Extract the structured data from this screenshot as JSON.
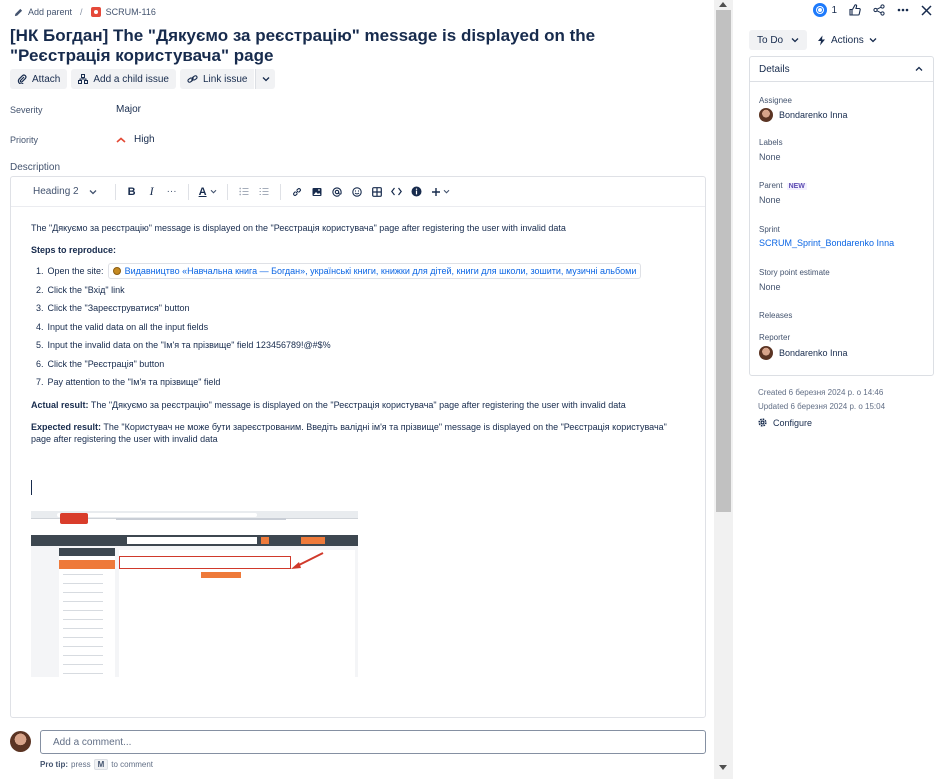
{
  "breadcrumb": {
    "add_parent": "Add parent",
    "separator": "/",
    "issue_key": "SCRUM-116"
  },
  "issue": {
    "title": "[НК Богдан] The \"Дякуємо за реєстрацію\" message is displayed on the \"Реєстрація користувача\" page"
  },
  "actions": {
    "attach": "Attach",
    "add_child": "Add a child issue",
    "link_issue": "Link issue"
  },
  "fields": {
    "severity_label": "Severity",
    "severity_value": "Major",
    "priority_label": "Priority",
    "priority_value": "High",
    "priority_color": "#e34935",
    "description_label": "Description"
  },
  "toolbar": {
    "heading": "Heading 2",
    "bold": "B",
    "italic": "I",
    "more": "···",
    "text_color": "A"
  },
  "description": {
    "intro": "The \"Дякуємо за реєстрацію\" message is displayed on the \"Реєстрація користувача\" page after registering the user with invalid data",
    "steps_heading": "Steps to reproduce:",
    "steps": [
      {
        "num": "1.",
        "text": "Open the site:",
        "link": "Видавництво «Навчальна книга — Богдан», українські книги, книжки для дітей, книги для школи, зошити, музичні альбоми"
      },
      {
        "num": "2.",
        "text": "Click the \"Вхід\" link"
      },
      {
        "num": "3.",
        "text": "Click the \"Зареєструватися\" button"
      },
      {
        "num": "4.",
        "text": "Input the valid data on all the input fields"
      },
      {
        "num": "5.",
        "text": "Input the invalid data on the \"Ім'я та прізвище\" field 123456789!@#$%"
      },
      {
        "num": "6.",
        "text": "Click the \"Реєстрація\" button"
      },
      {
        "num": "7.",
        "text": "Pay attention to the \"Ім'я та прізвище\" field"
      }
    ],
    "actual_label": "Actual result:",
    "actual_text": " The \"Дякуємо за реєстрацію\" message is displayed on the \"Реєстрація користувача\" page after registering the user with invalid data",
    "expected_label": "Expected result:",
    "expected_text": " The \"Користувач не може бути зареєстрованим. Введіть валідні ім'я та прізвище\" message is displayed on the \"Реєстрація користувача\" page after registering the user with invalid data"
  },
  "comment": {
    "placeholder": "Add a comment...",
    "protip_label": "Pro tip:",
    "protip_press": "press",
    "protip_key": "M",
    "protip_rest": "to comment"
  },
  "header_right": {
    "watchers_count": "1"
  },
  "status": {
    "label": "To Do",
    "actions_label": "Actions"
  },
  "details": {
    "title": "Details",
    "assignee_label": "Assignee",
    "assignee_name": "Bondarenko Inna",
    "labels_label": "Labels",
    "labels_value": "None",
    "parent_label": "Parent",
    "parent_badge": "NEW",
    "parent_value": "None",
    "sprint_label": "Sprint",
    "sprint_value": "SCRUM_Sprint_Bondarenko Inna",
    "story_points_label": "Story point estimate",
    "story_points_value": "None",
    "releases_label": "Releases",
    "reporter_label": "Reporter",
    "reporter_name": "Bondarenko Inna"
  },
  "meta": {
    "created": "Created 6 березня 2024 р. о 14:46",
    "updated": "Updated 6 березня 2024 р. о 15:04",
    "configure": "Configure"
  }
}
